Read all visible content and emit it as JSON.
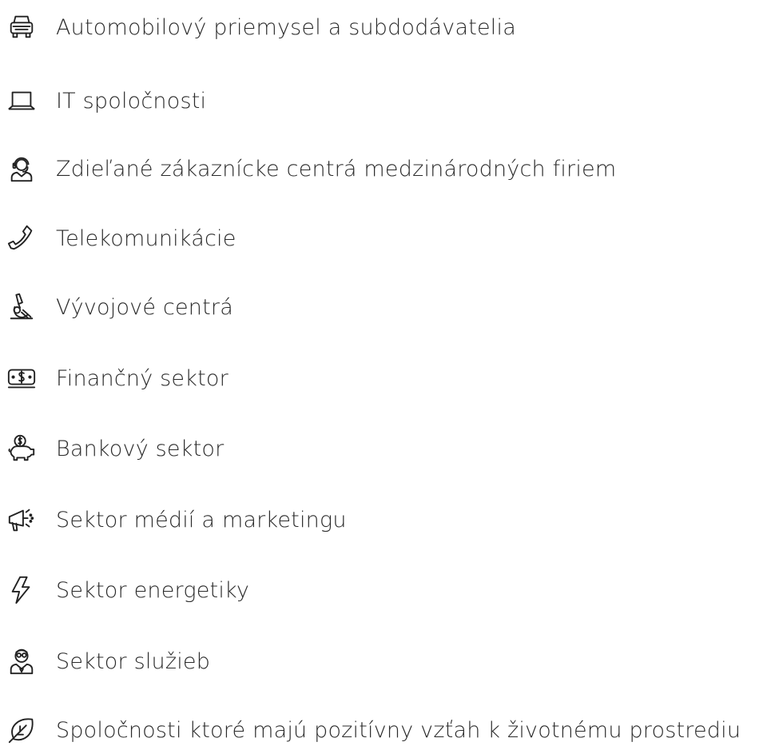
{
  "items": [
    {
      "icon": "car-icon",
      "label": "Automobilový priemysel a subdodávatelia"
    },
    {
      "icon": "laptop-icon",
      "label": "IT spoločnosti"
    },
    {
      "icon": "customer-support-icon",
      "label": "Zdieľané zákaznícke centrá medzinárodných firiem"
    },
    {
      "icon": "phone-icon",
      "label": "Telekomunikácie"
    },
    {
      "icon": "microscope-icon",
      "label": "Vývojové centrá"
    },
    {
      "icon": "money-bill-icon",
      "label": "Finančný sektor"
    },
    {
      "icon": "piggy-bank-icon",
      "label": "Bankový sektor"
    },
    {
      "icon": "megaphone-icon",
      "label": "Sektor médií a marketingu"
    },
    {
      "icon": "lightning-icon",
      "label": "Sektor energetiky"
    },
    {
      "icon": "service-agent-icon",
      "label": "Sektor služieb"
    },
    {
      "icon": "eco-leaf-icon",
      "label": "Spoločnosti ktoré majú pozitívny vzťah k životnému prostrediu"
    }
  ]
}
